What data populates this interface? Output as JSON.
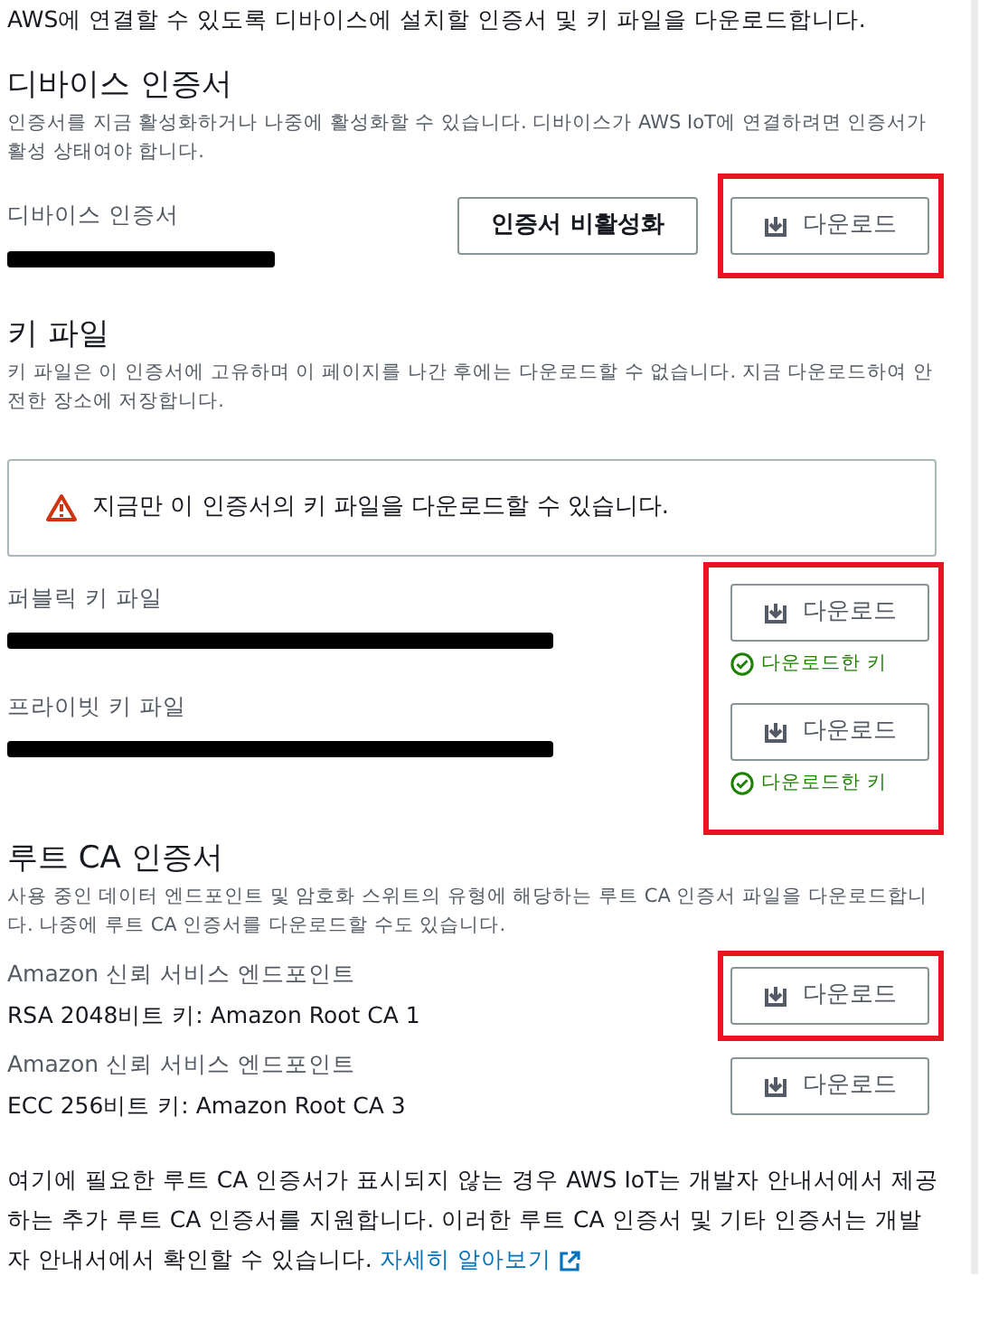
{
  "intro": "AWS에 연결할 수 있도록 디바이스에 설치할 인증서 및 키 파일을 다운로드합니다.",
  "device_certificate": {
    "heading": "디바이스 인증서",
    "description": "인증서를 지금 활성화하거나 나중에 활성화할 수 있습니다. 디바이스가 AWS IoT에 연결하려면 인증서가 활성 상태여야 합니다.",
    "label": "디바이스 인증서",
    "redacted": true,
    "buttons": [
      {
        "label": "인증서 비활성화",
        "kind": "secondary",
        "highlighted": false
      },
      {
        "label": "다운로드",
        "kind": "download",
        "highlighted": true
      }
    ]
  },
  "key_files": {
    "heading": "키 파일",
    "description": "키 파일은 이 인증서에 고유하며 이 페이지를 나간 후에는 다운로드할 수 없습니다. 지금 다운로드하여 안전한 장소에 저장합니다.",
    "alert": "지금만 이 인증서의 키 파일을 다운로드할 수 있습니다.",
    "highlighted": true,
    "files": [
      {
        "label": "퍼블릭 키 파일",
        "redacted": true,
        "button": "다운로드",
        "status": "다운로드한 키"
      },
      {
        "label": "프라이빗 키 파일",
        "redacted": true,
        "button": "다운로드",
        "status": "다운로드한 키"
      }
    ]
  },
  "root_ca": {
    "heading": "루트 CA 인증서",
    "description": "사용 중인 데이터 엔드포인트 및 암호화 스위트의 유형에 해당하는 루트 CA 인증서 파일을 다운로드합니다. 나중에 루트 CA 인증서를 다운로드할 수도 있습니다.",
    "items": [
      {
        "label": "Amazon 신뢰 서비스 엔드포인트",
        "value": "RSA 2048비트 키: Amazon Root CA 1",
        "button": "다운로드",
        "highlighted": true
      },
      {
        "label": "Amazon 신뢰 서비스 엔드포인트",
        "value": "ECC 256비트 키: Amazon Root CA 3",
        "button": "다운로드",
        "highlighted": false
      }
    ]
  },
  "footer": {
    "text": "여기에 필요한 루트 CA 인증서가 표시되지 않는 경우 AWS IoT는 개발자 안내서에서 제공하는 추가 루트 CA 인증서를 지원합니다. 이러한 루트 CA 인증서 및 기타 인증서는 개발자 안내서에서 확인할 수 있습니다.",
    "link": "자세히 알아보기"
  }
}
